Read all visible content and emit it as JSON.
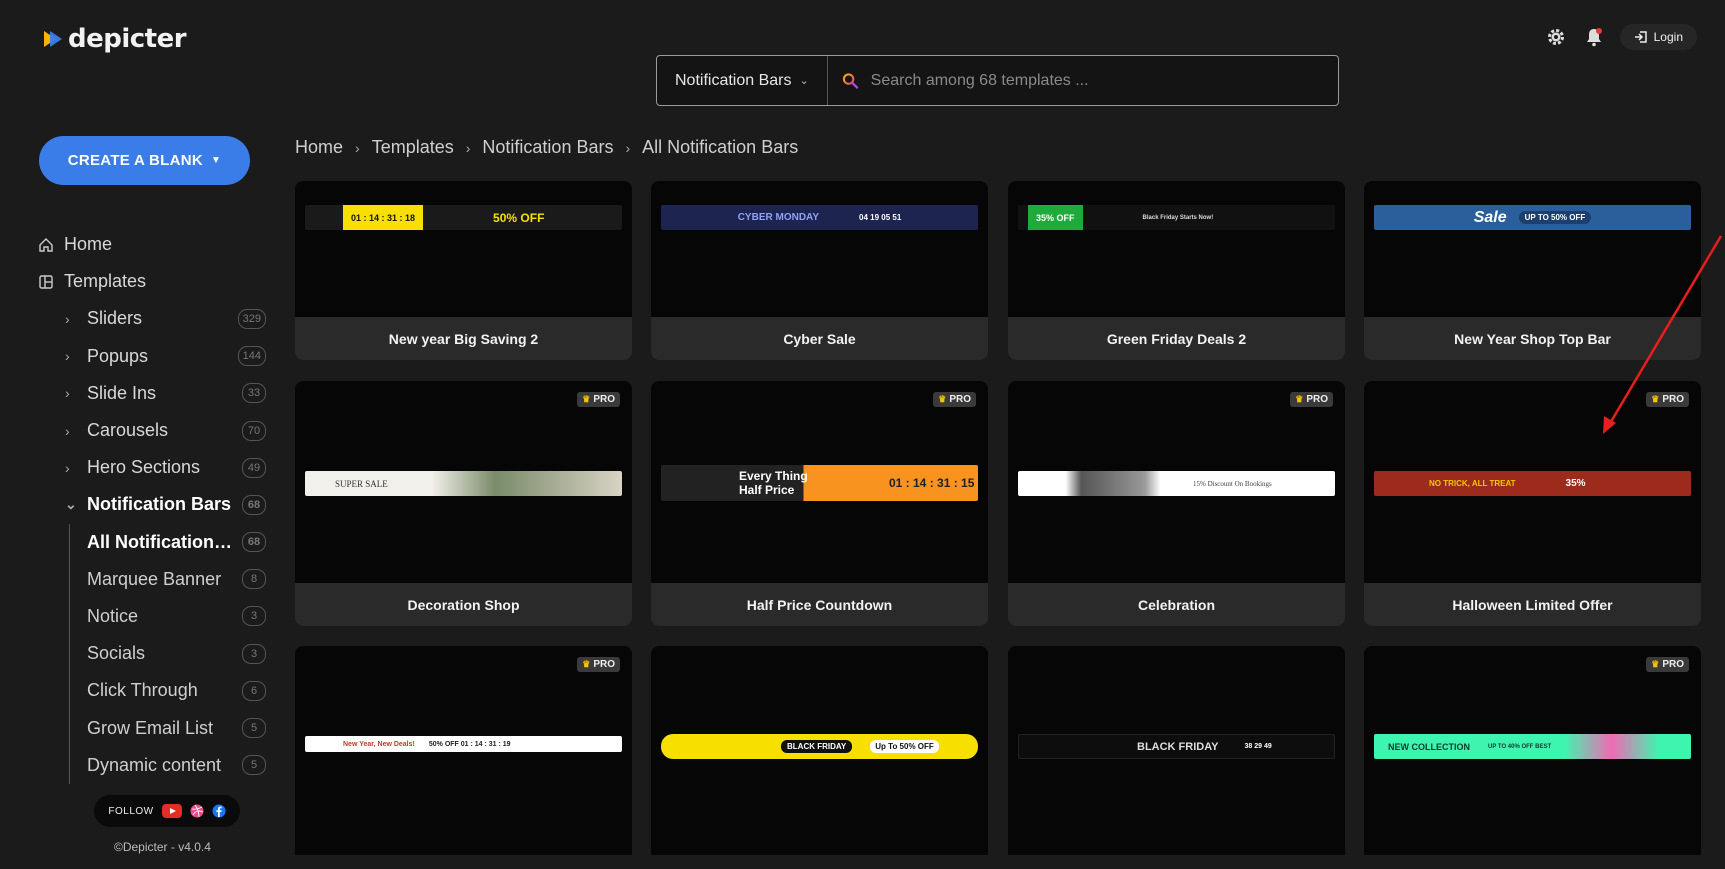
{
  "brand": {
    "name": "depicter"
  },
  "search": {
    "category": "Notification Bars",
    "placeholder": "Search among 68 templates ..."
  },
  "header": {
    "login_label": "Login"
  },
  "sidebar": {
    "create_label": "CREATE A BLANK",
    "home_label": "Home",
    "templates_label": "Templates",
    "categories": [
      {
        "label": "Sliders",
        "count": "329"
      },
      {
        "label": "Popups",
        "count": "144"
      },
      {
        "label": "Slide Ins",
        "count": "33"
      },
      {
        "label": "Carousels",
        "count": "70"
      },
      {
        "label": "Hero Sections",
        "count": "49"
      },
      {
        "label": "Notification Bars",
        "count": "68"
      }
    ],
    "subcategories": [
      {
        "label": "All Notification Bars",
        "count": "68"
      },
      {
        "label": "Marquee Banner",
        "count": "8"
      },
      {
        "label": "Notice",
        "count": "3"
      },
      {
        "label": "Socials",
        "count": "3"
      },
      {
        "label": "Click Through",
        "count": "6"
      },
      {
        "label": "Grow Email List",
        "count": "5"
      },
      {
        "label": "Dynamic content",
        "count": "5"
      }
    ],
    "follow_label": "FOLLOW",
    "version": "©Depicter - v4.0.4"
  },
  "breadcrumb": [
    "Home",
    "Templates",
    "Notification Bars",
    "All Notification Bars"
  ],
  "pro_label": "PRO",
  "templates": [
    {
      "title": "New year Big Saving 2",
      "pro": false,
      "banner_text": "01 : 14 : 31 : 18",
      "banner_extra": "50% OFF",
      "colors": [
        "#1a1a1a",
        "#f7e000"
      ]
    },
    {
      "title": "Cyber Sale",
      "pro": false,
      "banner_text": "CYBER MONDAY",
      "banner_extra": "04 19 05 51",
      "colors": [
        "#1d2450",
        "#3d5ad6"
      ]
    },
    {
      "title": "Green Friday Deals 2",
      "pro": false,
      "banner_text": "35% OFF",
      "banner_extra": "Black Friday Starts Now!",
      "colors": [
        "#111111",
        "#1faa3c"
      ]
    },
    {
      "title": "New Year Shop Top Bar",
      "pro": false,
      "banner_text": "Sale",
      "banner_extra": "UP TO 50% OFF",
      "colors": [
        "#2b5f9c",
        "#f7d34a"
      ]
    },
    {
      "title": "Decoration Shop",
      "pro": true,
      "banner_text": "SUPER SALE",
      "banner_extra": "",
      "colors": [
        "#f2f0ea",
        "#7a8b6a"
      ]
    },
    {
      "title": "Half Price Countdown",
      "pro": true,
      "banner_text": "Every Thing Half Price",
      "banner_extra": "01 : 14 : 31 : 15",
      "colors": [
        "#222222",
        "#f7931e"
      ]
    },
    {
      "title": "Celebration",
      "pro": true,
      "banner_text": "15% Discount On Bookings",
      "banner_extra": "",
      "colors": [
        "#ffffff",
        "#444444"
      ]
    },
    {
      "title": "Halloween Limited Offer",
      "pro": true,
      "banner_text": "NO TRICK, ALL TREAT",
      "banner_extra": "35%",
      "colors": [
        "#9c2b1d",
        "#f39c12"
      ]
    },
    {
      "title": "",
      "pro": true,
      "banner_text": "New Year, New Deals!",
      "banner_extra": "50% OFF  01 : 14 : 31 : 19",
      "colors": [
        "#ffffff",
        "#c0392b"
      ]
    },
    {
      "title": "",
      "pro": false,
      "banner_text": "BLACK FRIDAY",
      "banner_extra": "Up To 50% OFF",
      "colors": [
        "#f7e000",
        "#111111"
      ]
    },
    {
      "title": "",
      "pro": false,
      "banner_text": "BLACK FRIDAY",
      "banner_extra": "38 29 49",
      "colors": [
        "#0d0d0d",
        "#cccccc"
      ]
    },
    {
      "title": "",
      "pro": true,
      "banner_text": "NEW COLLECTION",
      "banner_extra": "UP TO 40% OFF BEST",
      "colors": [
        "#3ef5b0",
        "#f06bb5"
      ]
    }
  ]
}
